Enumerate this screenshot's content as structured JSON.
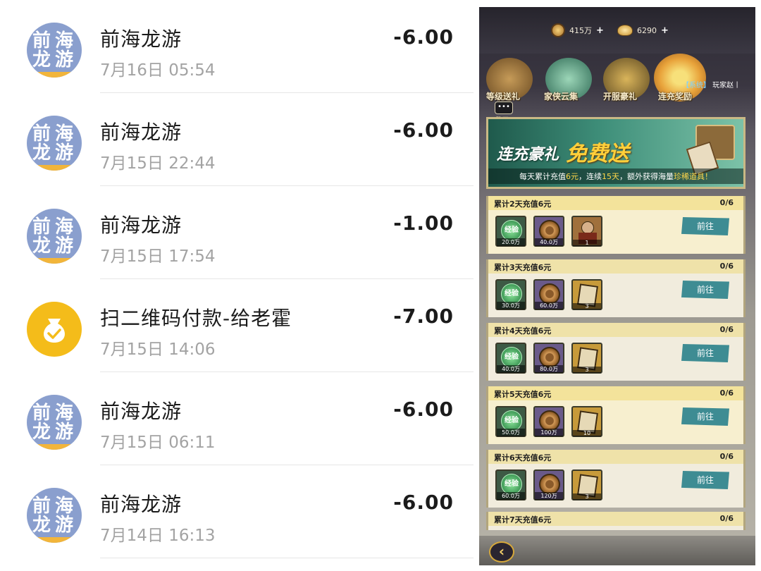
{
  "transactions": [
    {
      "title": "前海龙游",
      "time": "7月16日 05:54",
      "amount": "-6.00",
      "avatar": [
        "前",
        "海",
        "龙",
        "游"
      ],
      "avatar_type": "merchant"
    },
    {
      "title": "前海龙游",
      "time": "7月15日 22:44",
      "amount": "-6.00",
      "avatar": [
        "前",
        "海",
        "龙",
        "游"
      ],
      "avatar_type": "merchant"
    },
    {
      "title": "前海龙游",
      "time": "7月15日 17:54",
      "amount": "-1.00",
      "avatar": [
        "前",
        "海",
        "龙",
        "游"
      ],
      "avatar_type": "merchant"
    },
    {
      "title": "扫二维码付款-给老霍",
      "time": "7月15日 14:06",
      "amount": "-7.00",
      "avatar_type": "money-bag-icon"
    },
    {
      "title": "前海龙游",
      "time": "7月15日 06:11",
      "amount": "-6.00",
      "avatar": [
        "前",
        "海",
        "龙",
        "游"
      ],
      "avatar_type": "merchant"
    },
    {
      "title": "前海龙游",
      "time": "7月14日 16:13",
      "amount": "-6.00",
      "avatar": [
        "前",
        "海",
        "龙",
        "游"
      ],
      "avatar_type": "merchant"
    }
  ],
  "game": {
    "resources": {
      "copper": "415万",
      "gold": "6290"
    },
    "nav": [
      {
        "label": "等级送礼",
        "icon": "bull-treasure-icon"
      },
      {
        "label": "家侠云集",
        "icon": "cloud-orb-icon"
      },
      {
        "label": "开服豪礼",
        "icon": "treasure-pot-icon"
      },
      {
        "label": "连充奖励",
        "icon": "treasure-chest-icon"
      }
    ],
    "marquee": {
      "system": "【系统】",
      "text": " 玩家赵丨"
    },
    "chat_label": "聊天",
    "banner": {
      "headline_1": "连充豪礼",
      "headline_2": "免费送",
      "subtitle_a": "每天累计充值",
      "subtitle_b": "6元",
      "subtitle_c": "，连续",
      "subtitle_d": "15天",
      "subtitle_e": "，额外获得海量",
      "subtitle_f": "珍稀道具！"
    },
    "tasks": [
      {
        "name": "累计2天充值6元",
        "progress": "0/6",
        "button": "前往",
        "rewards": [
          {
            "type": "exp",
            "label": "经验",
            "qty": "20.0万"
          },
          {
            "type": "cash",
            "qty": "40.0万"
          },
          {
            "type": "figure",
            "qty": "1"
          }
        ]
      },
      {
        "name": "累计3天充值6元",
        "progress": "0/6",
        "button": "前往",
        "rewards": [
          {
            "type": "exp",
            "label": "经验",
            "qty": "30.0万"
          },
          {
            "type": "cash",
            "qty": "60.0万"
          },
          {
            "type": "card",
            "qty": "3"
          }
        ]
      },
      {
        "name": "累计4天充值6元",
        "progress": "0/6",
        "button": "前往",
        "rewards": [
          {
            "type": "exp",
            "label": "经验",
            "qty": "40.0万"
          },
          {
            "type": "cash",
            "qty": "80.0万"
          },
          {
            "type": "card",
            "qty": "3"
          }
        ]
      },
      {
        "name": "累计5天充值6元",
        "progress": "0/6",
        "button": "前往",
        "rewards": [
          {
            "type": "exp",
            "label": "经验",
            "qty": "50.0万"
          },
          {
            "type": "cash",
            "qty": "100万"
          },
          {
            "type": "card",
            "qty": "10"
          }
        ]
      },
      {
        "name": "累计6天充值6元",
        "progress": "0/6",
        "button": "前往",
        "rewards": [
          {
            "type": "exp",
            "label": "经验",
            "qty": "60.0万"
          },
          {
            "type": "cash",
            "qty": "120万"
          },
          {
            "type": "card",
            "qty": "3"
          }
        ]
      },
      {
        "name": "累计7天充值6元",
        "progress": "0/6",
        "button": "前往",
        "rewards": []
      }
    ],
    "back_icon": "chevron-left-icon"
  }
}
